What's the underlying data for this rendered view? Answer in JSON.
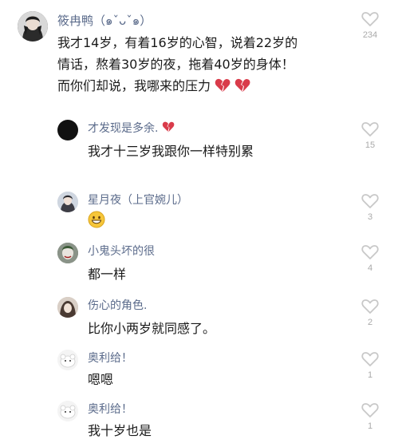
{
  "comments": [
    {
      "username": "筱冉鸭（๑ˇᴗˇ๑）",
      "lines": [
        "我才14岁，有着16岁的心智，说着22岁的",
        "情话，熬着30岁的夜，拖着40岁的身体！",
        "而你们却说，我哪来的压力"
      ],
      "emoji": "broken-heart-icon ×2",
      "likes": "234"
    },
    {
      "username": "才发现是多余.",
      "username_emoji": "broken-heart-icon",
      "text": "我才十三岁我跟你一样特别累",
      "likes": "15"
    },
    {
      "username": "星月夜（上官婉儿）",
      "text_emoji": "grinning-face-icon",
      "likes": "3"
    },
    {
      "username": "小鬼头坏的很",
      "text": "都一样",
      "likes": "4"
    },
    {
      "username": "伤心的角色.",
      "text": "比你小两岁就同感了。",
      "likes": "2"
    },
    {
      "username": "奥利给！",
      "text": "嗯嗯",
      "likes": "1"
    },
    {
      "username": "奥利给！",
      "text": "我十岁也是",
      "likes": "1"
    }
  ],
  "colors": {
    "username": "#5b6b8b",
    "body_text": "#1a1a1a",
    "like_icon": "#c8c8c8",
    "like_count": "#aaaaaa",
    "heart_emoji": "#d93b4a"
  }
}
